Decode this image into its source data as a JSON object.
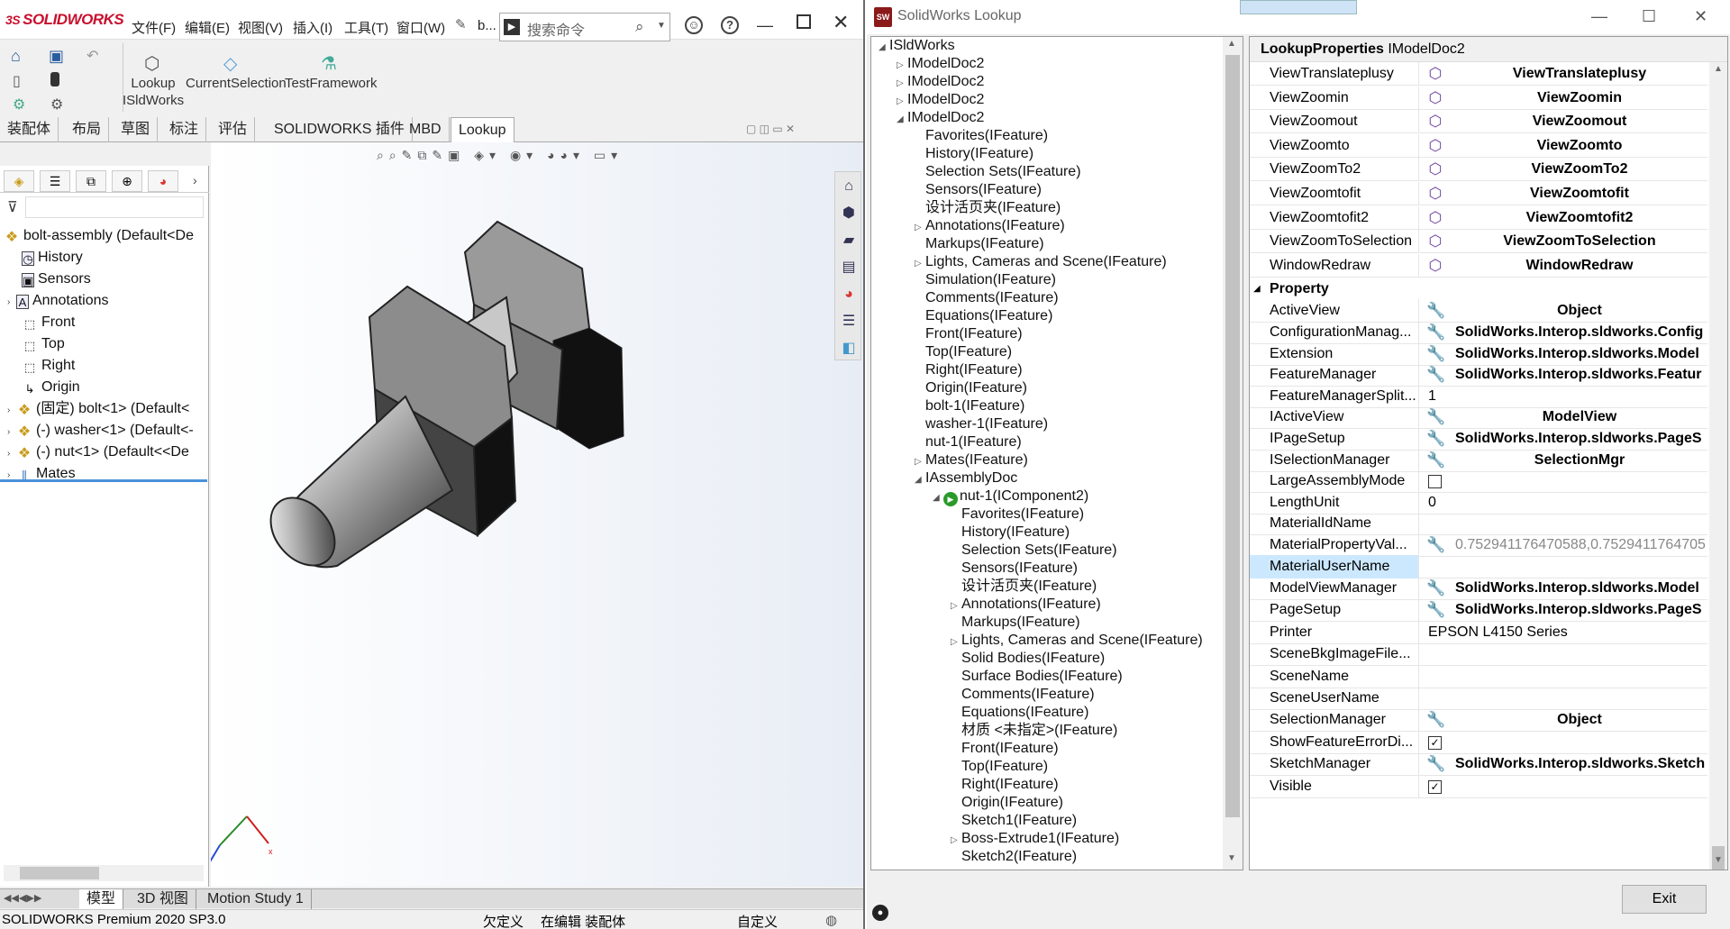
{
  "solidworks": {
    "brand": "SOLIDWORKS",
    "menu": [
      "文件(F)",
      "编辑(E)",
      "视图(V)",
      "插入(I)",
      "工具(T)",
      "窗口(W)"
    ],
    "doc_short": "b...",
    "search_placeholder": "搜索命令",
    "toolbar": {
      "lookup": "Lookup",
      "lookup_sub": "ISldWorks",
      "current_selection": "CurrentSelection",
      "test_framework": "TestFramework"
    },
    "cm_tabs": [
      "装配体",
      "布局",
      "草图",
      "标注",
      "评估",
      "SOLIDWORKS 插件",
      "MBD",
      "Lookup"
    ],
    "tree": [
      {
        "label": "bolt-assembly  (Default<De",
        "icon": "assembly-icon"
      },
      {
        "label": "History",
        "icon": "history-icon"
      },
      {
        "label": "Sensors",
        "icon": "sensors-icon"
      },
      {
        "label": "Annotations",
        "icon": "annotations-icon"
      },
      {
        "label": "Front",
        "icon": "plane-icon"
      },
      {
        "label": "Top",
        "icon": "plane-icon"
      },
      {
        "label": "Right",
        "icon": "plane-icon"
      },
      {
        "label": "Origin",
        "icon": "origin-icon"
      },
      {
        "label": "(固定) bolt<1> (Default<",
        "icon": "part-icon"
      },
      {
        "label": "(-) washer<1> (Default<-",
        "icon": "part-icon"
      },
      {
        "label": "(-) nut<1> (Default<<De",
        "icon": "part-icon"
      },
      {
        "label": "Mates",
        "icon": "mates-icon"
      }
    ],
    "bottom_tabs": [
      "模型",
      "3D 视图",
      "Motion Study 1"
    ],
    "status": {
      "product": "SOLIDWORKS Premium 2020 SP3.0",
      "defined": "欠定义",
      "editing": "在编辑 装配体",
      "custom": "自定义"
    }
  },
  "lookup": {
    "title": "SolidWorks Lookup",
    "tree": [
      {
        "label": "ISldWorks",
        "indent": 0,
        "arrow": "down"
      },
      {
        "label": "IModelDoc2",
        "indent": 1,
        "arrow": "right"
      },
      {
        "label": "IModelDoc2",
        "indent": 1,
        "arrow": "right"
      },
      {
        "label": "IModelDoc2",
        "indent": 1,
        "arrow": "right"
      },
      {
        "label": "IModelDoc2",
        "indent": 1,
        "arrow": "down"
      },
      {
        "label": "Favorites(IFeature)",
        "indent": 2,
        "arrow": ""
      },
      {
        "label": "History(IFeature)",
        "indent": 2,
        "arrow": ""
      },
      {
        "label": "Selection Sets(IFeature)",
        "indent": 2,
        "arrow": ""
      },
      {
        "label": "Sensors(IFeature)",
        "indent": 2,
        "arrow": ""
      },
      {
        "label": "设计活页夹(IFeature)",
        "indent": 2,
        "arrow": ""
      },
      {
        "label": "Annotations(IFeature)",
        "indent": 2,
        "arrow": "right"
      },
      {
        "label": "Markups(IFeature)",
        "indent": 2,
        "arrow": ""
      },
      {
        "label": "Lights, Cameras and Scene(IFeature)",
        "indent": 2,
        "arrow": "right"
      },
      {
        "label": "Simulation(IFeature)",
        "indent": 2,
        "arrow": ""
      },
      {
        "label": "Comments(IFeature)",
        "indent": 2,
        "arrow": ""
      },
      {
        "label": "Equations(IFeature)",
        "indent": 2,
        "arrow": ""
      },
      {
        "label": "Front(IFeature)",
        "indent": 2,
        "arrow": ""
      },
      {
        "label": "Top(IFeature)",
        "indent": 2,
        "arrow": ""
      },
      {
        "label": "Right(IFeature)",
        "indent": 2,
        "arrow": ""
      },
      {
        "label": "Origin(IFeature)",
        "indent": 2,
        "arrow": ""
      },
      {
        "label": "bolt-1(IFeature)",
        "indent": 2,
        "arrow": ""
      },
      {
        "label": "washer-1(IFeature)",
        "indent": 2,
        "arrow": ""
      },
      {
        "label": "nut-1(IFeature)",
        "indent": 2,
        "arrow": ""
      },
      {
        "label": "Mates(IFeature)",
        "indent": 2,
        "arrow": "right"
      },
      {
        "label": "IAssemblyDoc",
        "indent": 2,
        "arrow": "down"
      },
      {
        "label": "nut-1(IComponent2)",
        "indent": 3,
        "arrow": "down",
        "play": true
      },
      {
        "label": "Favorites(IFeature)",
        "indent": 4,
        "arrow": ""
      },
      {
        "label": "History(IFeature)",
        "indent": 4,
        "arrow": ""
      },
      {
        "label": "Selection Sets(IFeature)",
        "indent": 4,
        "arrow": ""
      },
      {
        "label": "Sensors(IFeature)",
        "indent": 4,
        "arrow": ""
      },
      {
        "label": "设计活页夹(IFeature)",
        "indent": 4,
        "arrow": ""
      },
      {
        "label": "Annotations(IFeature)",
        "indent": 4,
        "arrow": "right"
      },
      {
        "label": "Markups(IFeature)",
        "indent": 4,
        "arrow": ""
      },
      {
        "label": "Lights, Cameras and Scene(IFeature)",
        "indent": 4,
        "arrow": "right"
      },
      {
        "label": "Solid Bodies(IFeature)",
        "indent": 4,
        "arrow": ""
      },
      {
        "label": "Surface Bodies(IFeature)",
        "indent": 4,
        "arrow": ""
      },
      {
        "label": "Comments(IFeature)",
        "indent": 4,
        "arrow": ""
      },
      {
        "label": "Equations(IFeature)",
        "indent": 4,
        "arrow": ""
      },
      {
        "label": "材质 <未指定>(IFeature)",
        "indent": 4,
        "arrow": ""
      },
      {
        "label": "Front(IFeature)",
        "indent": 4,
        "arrow": ""
      },
      {
        "label": "Top(IFeature)",
        "indent": 4,
        "arrow": ""
      },
      {
        "label": "Right(IFeature)",
        "indent": 4,
        "arrow": ""
      },
      {
        "label": "Origin(IFeature)",
        "indent": 4,
        "arrow": ""
      },
      {
        "label": "Sketch1(IFeature)",
        "indent": 4,
        "arrow": ""
      },
      {
        "label": "Boss-Extrude1(IFeature)",
        "indent": 4,
        "arrow": "right"
      },
      {
        "label": "Sketch2(IFeature)",
        "indent": 4,
        "arrow": ""
      }
    ],
    "props_header": {
      "label": "LookupProperties",
      "type": "IModelDoc2"
    },
    "method_rows": [
      {
        "name": "ViewTranslateplusy",
        "value": "ViewTranslateplusy"
      },
      {
        "name": "ViewZoomin",
        "value": "ViewZoomin"
      },
      {
        "name": "ViewZoomout",
        "value": "ViewZoomout"
      },
      {
        "name": "ViewZoomto",
        "value": "ViewZoomto"
      },
      {
        "name": "ViewZoomTo2",
        "value": "ViewZoomTo2"
      },
      {
        "name": "ViewZoomtofit",
        "value": "ViewZoomtofit"
      },
      {
        "name": "ViewZoomtofit2",
        "value": "ViewZoomtofit2"
      },
      {
        "name": "ViewZoomToSelection",
        "value": "ViewZoomToSelection"
      },
      {
        "name": "WindowRedraw",
        "value": "WindowRedraw"
      }
    ],
    "property_category": "Property",
    "property_rows": [
      {
        "name": "ActiveView",
        "kind": "wrench",
        "value": "Object",
        "center": true
      },
      {
        "name": "ConfigurationManag...",
        "kind": "wrench",
        "value": "SolidWorks.Interop.sldworks.Config"
      },
      {
        "name": "Extension",
        "kind": "wrench",
        "value": "SolidWorks.Interop.sldworks.Model"
      },
      {
        "name": "FeatureManager",
        "kind": "wrench",
        "value": "SolidWorks.Interop.sldworks.Featur"
      },
      {
        "name": "FeatureManagerSplit...",
        "kind": "text",
        "value": "1"
      },
      {
        "name": "IActiveView",
        "kind": "wrench",
        "value": "ModelView",
        "center": true
      },
      {
        "name": "IPageSetup",
        "kind": "wrench",
        "value": "SolidWorks.Interop.sldworks.PageS"
      },
      {
        "name": "ISelectionManager",
        "kind": "wrench",
        "value": "SelectionMgr",
        "center": true
      },
      {
        "name": "LargeAssemblyMode",
        "kind": "check",
        "checked": false
      },
      {
        "name": "LengthUnit",
        "kind": "text",
        "value": "0"
      },
      {
        "name": "MaterialIdName",
        "kind": "text",
        "value": ""
      },
      {
        "name": "MaterialPropertyVal...",
        "kind": "wrench-gray",
        "value": "0.752941176470588,0.7529411764705"
      },
      {
        "name": "MaterialUserName",
        "kind": "text",
        "value": "",
        "selected": true
      },
      {
        "name": "ModelViewManager",
        "kind": "wrench",
        "value": "SolidWorks.Interop.sldworks.Model"
      },
      {
        "name": "PageSetup",
        "kind": "wrench",
        "value": "SolidWorks.Interop.sldworks.PageS"
      },
      {
        "name": "Printer",
        "kind": "text",
        "value": "EPSON L4150 Series"
      },
      {
        "name": "SceneBkgImageFile...",
        "kind": "text",
        "value": ""
      },
      {
        "name": "SceneName",
        "kind": "text",
        "value": ""
      },
      {
        "name": "SceneUserName",
        "kind": "text",
        "value": ""
      },
      {
        "name": "SelectionManager",
        "kind": "wrench",
        "value": "Object",
        "center": true
      },
      {
        "name": "ShowFeatureErrorDi...",
        "kind": "check",
        "checked": true
      },
      {
        "name": "SketchManager",
        "kind": "wrench",
        "value": "SolidWorks.Interop.sldworks.Sketch"
      },
      {
        "name": "Visible",
        "kind": "check",
        "checked": true
      }
    ],
    "exit_label": "Exit"
  }
}
